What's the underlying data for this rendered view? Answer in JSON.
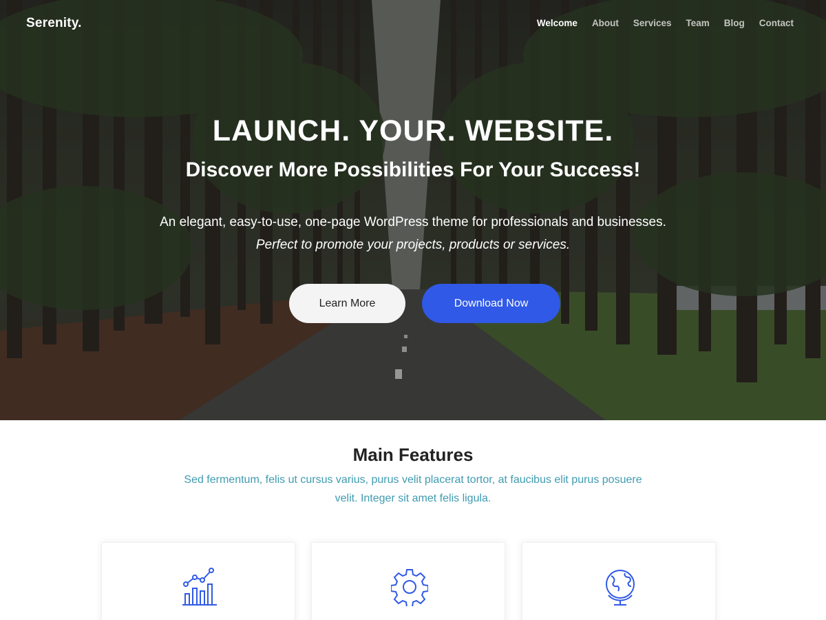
{
  "brand": "Serenity.",
  "nav": {
    "items": [
      "Welcome",
      "About",
      "Services",
      "Team",
      "Blog",
      "Contact"
    ],
    "active": "Welcome"
  },
  "hero": {
    "headline": "LAUNCH. YOUR. WEBSITE.",
    "subheadline": "Discover More Possibilities For Your Success!",
    "description": "An elegant, easy-to-use, one-page WordPress theme for professionals and businesses.",
    "tagline": "Perfect to promote your projects, products or services.",
    "learn_more_label": "Learn More",
    "download_label": "Download Now"
  },
  "features": {
    "title": "Main Features",
    "text": "Sed fermentum, felis ut cursus varius, purus velit placerat tortor, at faucibus elit purus posuere velit. Integer sit amet felis ligula.",
    "cards": [
      {
        "icon": "chart-icon"
      },
      {
        "icon": "gear-icon"
      },
      {
        "icon": "globe-icon"
      }
    ]
  },
  "colors": {
    "accent": "#2f59e6",
    "features_text": "#3f9bb0"
  }
}
